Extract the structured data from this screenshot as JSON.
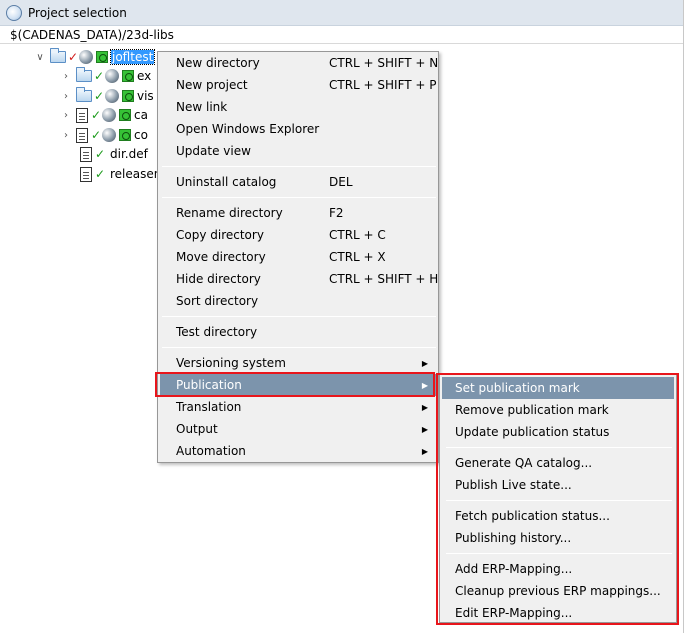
{
  "window": {
    "title": "Project selection"
  },
  "path": "$(CADENAS_DATA)/23d-libs",
  "tree": {
    "root_label": "jofltest",
    "children": [
      {
        "label": "ex"
      },
      {
        "label": "vis"
      },
      {
        "label": "ca"
      },
      {
        "label": "co"
      },
      {
        "label": "dir.def"
      },
      {
        "label": "releasen"
      }
    ]
  },
  "context_menu": {
    "items": [
      {
        "label": "New directory",
        "shortcut": "CTRL + SHIFT + N"
      },
      {
        "label": "New project",
        "shortcut": "CTRL + SHIFT + P"
      },
      {
        "label": "New link",
        "shortcut": ""
      },
      {
        "label": "Open Windows Explorer",
        "shortcut": ""
      },
      {
        "label": "Update view",
        "shortcut": ""
      },
      {
        "label": "Uninstall catalog",
        "shortcut": "DEL"
      },
      {
        "label": "Rename directory",
        "shortcut": "F2"
      },
      {
        "label": "Copy directory",
        "shortcut": "CTRL + C"
      },
      {
        "label": "Move directory",
        "shortcut": "CTRL + X"
      },
      {
        "label": "Hide directory",
        "shortcut": "CTRL + SHIFT + H"
      },
      {
        "label": "Sort directory",
        "shortcut": ""
      },
      {
        "label": "Test directory",
        "shortcut": ""
      },
      {
        "label": "Versioning system",
        "shortcut": ""
      },
      {
        "label": "Publication",
        "shortcut": ""
      },
      {
        "label": "Translation",
        "shortcut": ""
      },
      {
        "label": "Output",
        "shortcut": ""
      },
      {
        "label": "Automation",
        "shortcut": ""
      }
    ],
    "highlighted": "Publication"
  },
  "publication_submenu": {
    "items": [
      {
        "label": "Set publication mark"
      },
      {
        "label": "Remove publication mark"
      },
      {
        "label": "Update publication status"
      },
      {
        "label": "Generate QA catalog..."
      },
      {
        "label": "Publish Live state..."
      },
      {
        "label": "Fetch publication status..."
      },
      {
        "label": "Publishing history..."
      },
      {
        "label": "Add ERP-Mapping..."
      },
      {
        "label": "Cleanup previous ERP mappings..."
      },
      {
        "label": "Edit ERP-Mapping..."
      }
    ],
    "highlighted": "Set publication mark"
  },
  "colors": {
    "highlight": "#7c94ac",
    "annotation_red": "#e8151b",
    "check_green": "#1a9a1a",
    "selection_blue": "#3399ff"
  }
}
